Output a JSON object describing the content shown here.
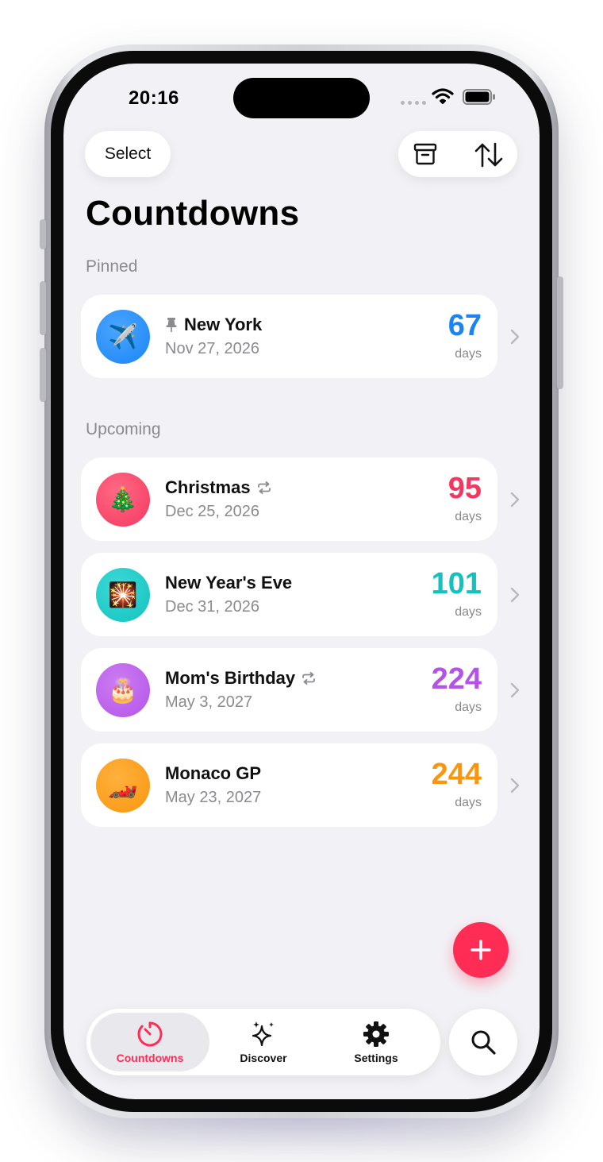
{
  "status_bar": {
    "time": "20:16"
  },
  "header": {
    "select_label": "Select",
    "archive_icon": "archive-box-icon",
    "sort_icon": "sort-arrows-icon"
  },
  "title": "Countdowns",
  "pinned": {
    "heading": "Pinned",
    "items": [
      {
        "name": "New York",
        "date": "Nov 27, 2026",
        "count": "67",
        "unit": "days",
        "color": "#1a84f5",
        "emoji": "✈️",
        "pinned": true,
        "repeat": false
      }
    ]
  },
  "upcoming": {
    "heading": "Upcoming",
    "items": [
      {
        "name": "Christmas",
        "date": "Dec 25, 2026",
        "count": "95",
        "unit": "days",
        "color": "#f5375f",
        "emoji": "🎄",
        "pinned": false,
        "repeat": true
      },
      {
        "name": "New Year's Eve",
        "date": "Dec 31, 2026",
        "count": "101",
        "unit": "days",
        "color": "#12c2bf",
        "emoji": "🎇",
        "pinned": false,
        "repeat": false
      },
      {
        "name": "Mom's Birthday",
        "date": "May 3, 2027",
        "count": "224",
        "unit": "days",
        "color": "#b354e8",
        "emoji": "🎂",
        "pinned": false,
        "repeat": true
      },
      {
        "name": "Monaco GP",
        "date": "May 23, 2027",
        "count": "244",
        "unit": "days",
        "color": "#f9960e",
        "emoji": "🏎️",
        "pinned": false,
        "repeat": false
      }
    ]
  },
  "tabs": [
    {
      "label": "Countdowns",
      "icon": "timer-icon",
      "active": true
    },
    {
      "label": "Discover",
      "icon": "sparkles-icon",
      "active": false
    },
    {
      "label": "Settings",
      "icon": "gear-icon",
      "active": false
    }
  ],
  "accent_color": "#ff2d55"
}
